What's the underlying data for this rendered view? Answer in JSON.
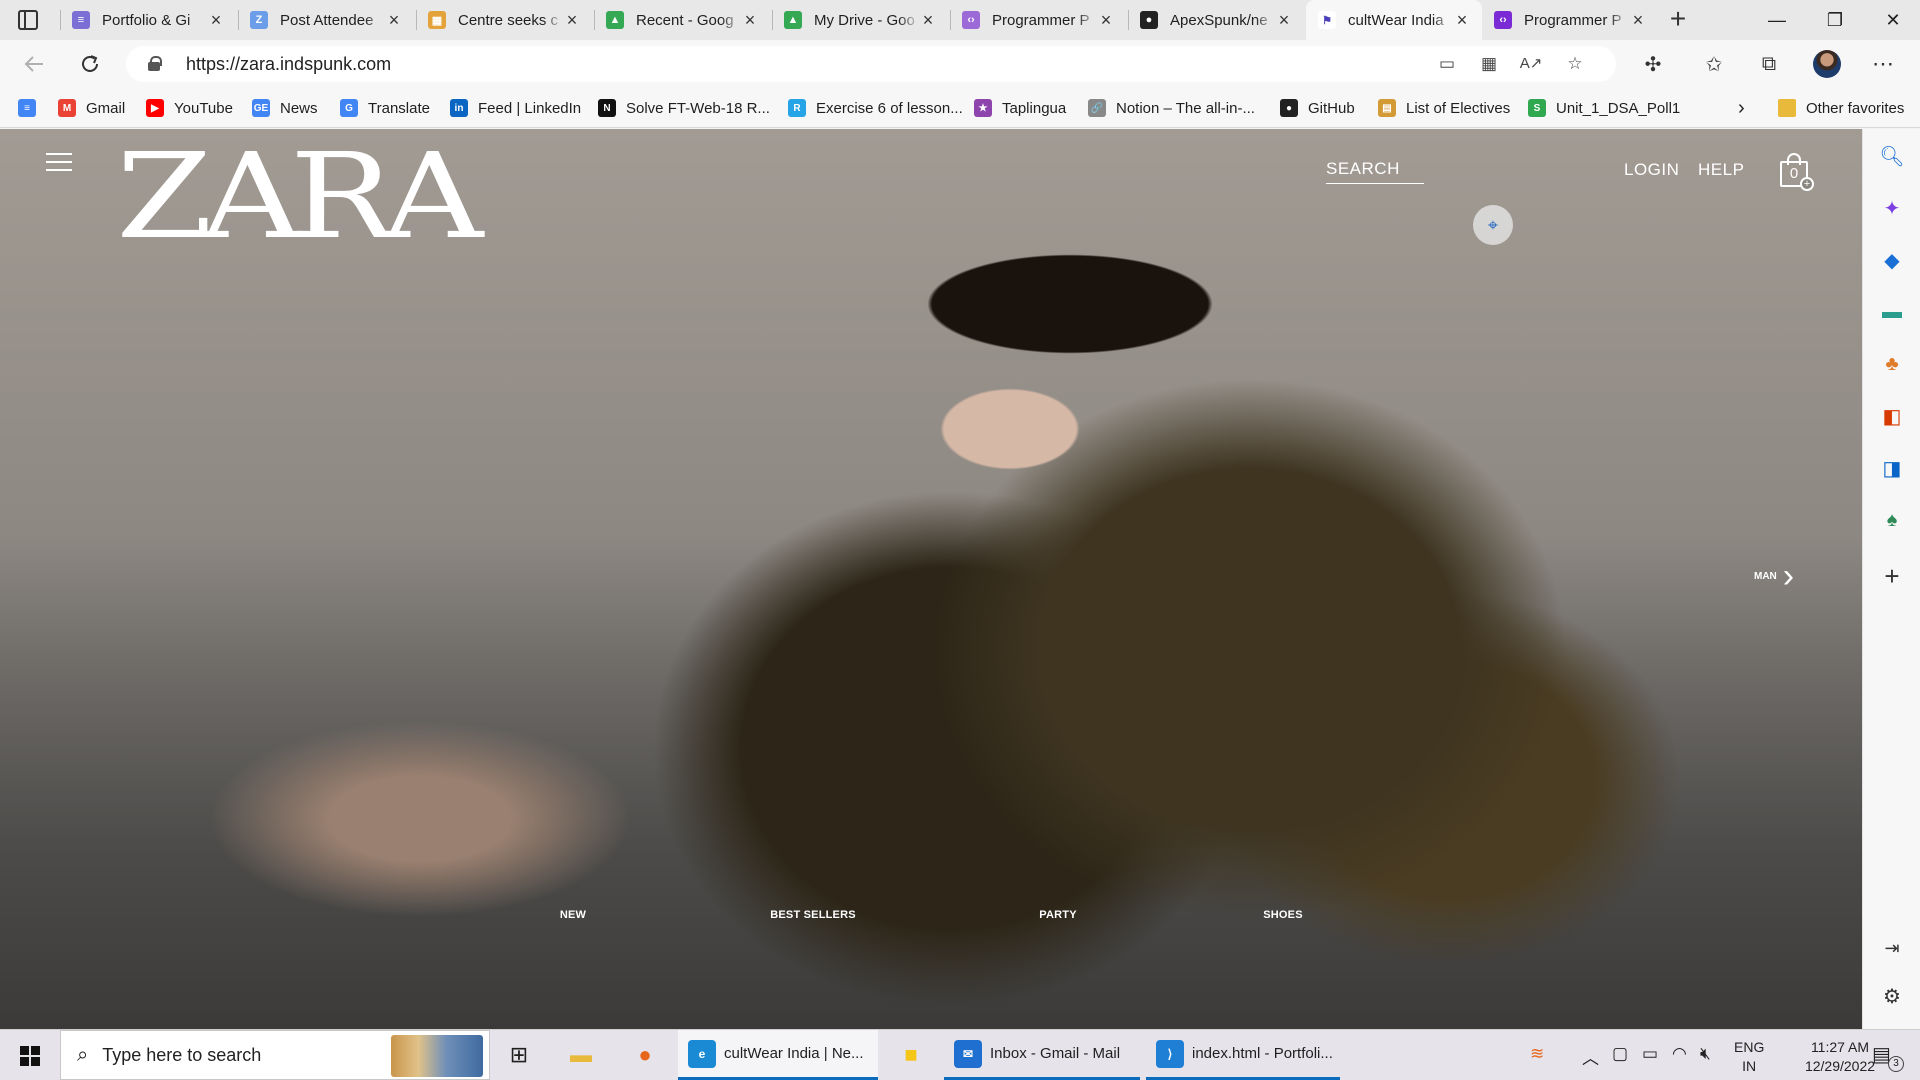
{
  "browser": {
    "tabs": [
      {
        "title": "Portfolio & Gi",
        "color": "#7b6fd6",
        "glyph": "≡"
      },
      {
        "title": "Post Attendee",
        "color": "#6b9de8",
        "glyph": "Z"
      },
      {
        "title": "Centre seeks c",
        "color": "#e4a33a",
        "glyph": "▦"
      },
      {
        "title": "Recent - Goog",
        "color": "#34a853",
        "glyph": "▲"
      },
      {
        "title": "My Drive - Goo",
        "color": "#34a853",
        "glyph": "▲"
      },
      {
        "title": "Programmer P",
        "color": "#9b6ad6",
        "glyph": "‹›"
      },
      {
        "title": "ApexSpunk/ne",
        "color": "#222222",
        "glyph": "●"
      },
      {
        "title": "cultWear India",
        "color": "#ffffff",
        "glyph": "⚑"
      },
      {
        "title": "Programmer P",
        "color": "#7a2bd6",
        "glyph": "‹›"
      }
    ],
    "new_tab": "+",
    "window_controls": {
      "minimize": "—",
      "maximize": "❐",
      "close": "✕"
    },
    "url": "https://zara.indspunk.com",
    "bookmarks": [
      {
        "label": "",
        "color": "#4285f4",
        "glyph": "≡"
      },
      {
        "label": "Gmail",
        "color": "#ea4335",
        "glyph": "M"
      },
      {
        "label": "YouTube",
        "color": "#ff0000",
        "glyph": "▶"
      },
      {
        "label": "News",
        "color": "#4285f4",
        "glyph": "GE"
      },
      {
        "label": "Translate",
        "color": "#4285f4",
        "glyph": "G"
      },
      {
        "label": "Feed | LinkedIn",
        "color": "#0a66c2",
        "glyph": "in"
      },
      {
        "label": "Solve FT-Web-18 R...",
        "color": "#111111",
        "glyph": "N"
      },
      {
        "label": "Exercise 6 of lesson...",
        "color": "#27a3e8",
        "glyph": "R"
      },
      {
        "label": "Taplingua",
        "color": "#8e44ad",
        "glyph": "★"
      },
      {
        "label": "Notion – The all-in-...",
        "color": "#888888",
        "glyph": "🔗"
      },
      {
        "label": "GitHub",
        "color": "#222222",
        "glyph": "●"
      },
      {
        "label": "List of Electives",
        "color": "#d49a35",
        "glyph": "▤"
      },
      {
        "label": "Unit_1_DSA_Poll1",
        "color": "#2fa84f",
        "glyph": "S"
      }
    ],
    "bookmarks_more": "›",
    "other_favorites": "Other favorites"
  },
  "site": {
    "logo": "ZARA",
    "search": "SEARCH",
    "login": "LOGIN",
    "help": "HELP",
    "bag_count": "0",
    "next_label": "MAN",
    "categories": [
      {
        "label": "NEW"
      },
      {
        "label": "BEST SELLERS"
      },
      {
        "label": "PARTY"
      },
      {
        "label": "SHOES"
      }
    ]
  },
  "taskbar": {
    "search_placeholder": "Type here to search",
    "apps": [
      {
        "label": "cultWear India | Ne...",
        "color": "#1a8ad4",
        "glyph": "e"
      },
      {
        "label": "Inbox - Gmail - Mail",
        "color": "#1e6fd0",
        "glyph": "✉"
      },
      {
        "label": "index.html - Portfoli...",
        "color": "#1f7fd4",
        "glyph": "⟩"
      }
    ],
    "lang_top": "ENG",
    "lang_bottom": "IN",
    "time": "11:27 AM",
    "date": "12/29/2022",
    "notification_count": "3"
  }
}
